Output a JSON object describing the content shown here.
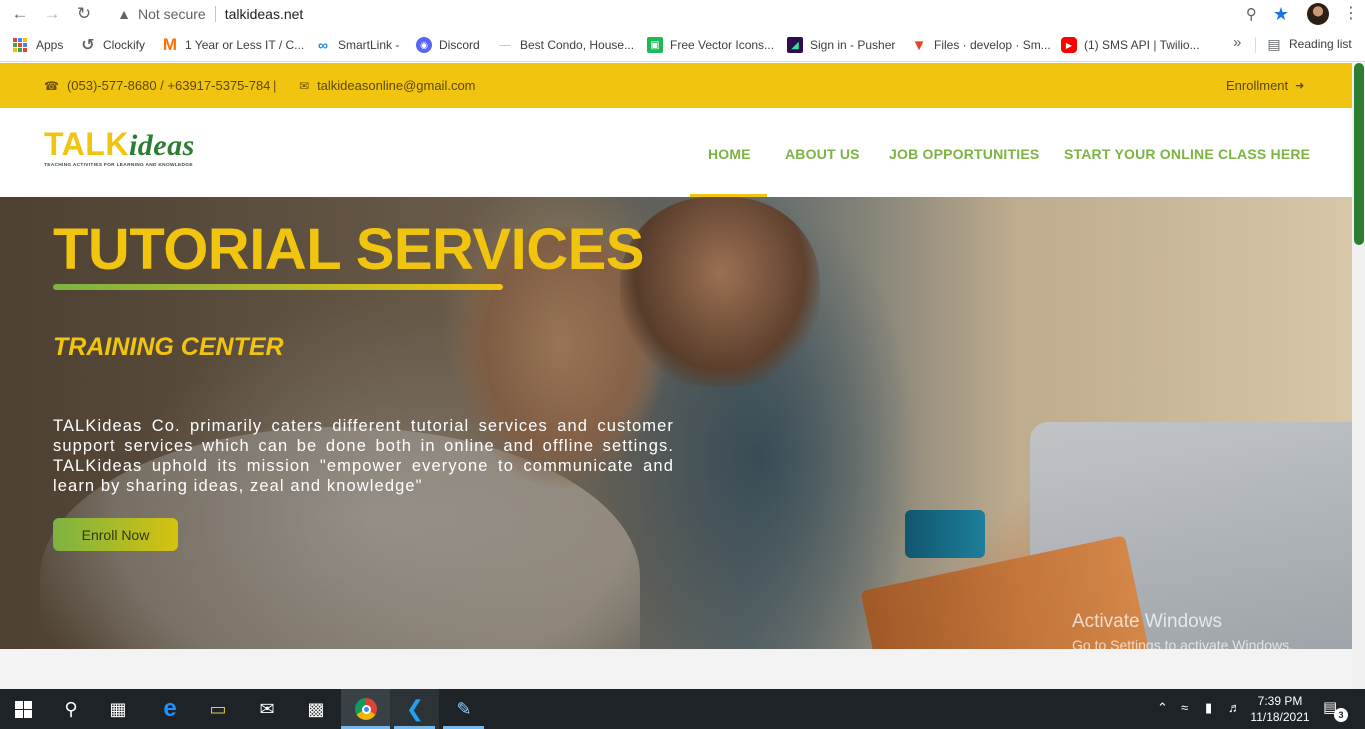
{
  "browser": {
    "not_secure": "Not secure",
    "url": "talkideas.net",
    "bookmarks": [
      {
        "label": "Apps",
        "icon": "apps-grid-icon"
      },
      {
        "label": "Clockify",
        "icon": "clockify-icon",
        "color": "#03a9f4"
      },
      {
        "label": "1 Year or Less IT / C...",
        "icon": "m-logo-icon",
        "color": "#ff6f00"
      },
      {
        "label": "SmartLink -",
        "icon": "link-icon",
        "color": "#1e88e5"
      },
      {
        "label": "Discord",
        "icon": "discord-icon",
        "color": "#5865f2"
      },
      {
        "label": "Best Condo, House...",
        "icon": "condo-icon",
        "color": "#90a4ae"
      },
      {
        "label": "Free Vector Icons...",
        "icon": "vector-icons-icon",
        "color": "#1db954"
      },
      {
        "label": "Sign in - Pusher",
        "icon": "pusher-icon",
        "color": "#300d4f"
      },
      {
        "label": "Files · develop · Sm...",
        "icon": "gitlab-icon",
        "color": "#e24329"
      },
      {
        "label": "(1) SMS API | Twilio...",
        "icon": "youtube-icon",
        "color": "#ff0000"
      }
    ],
    "more": "»",
    "reading_list": "Reading list"
  },
  "topbar": {
    "phone": "(053)-577-8680 / +63917-5375-784",
    "separator": "|",
    "email": "talkideasonline@gmail.com",
    "enrollment": "Enrollment"
  },
  "header": {
    "logo_talk": "TALK",
    "logo_ideas": "ideas",
    "logo_tagline": "TEACHING ACTIVITIES FOR LEARNING AND KNOWLEDGE",
    "nav": [
      "HOME",
      "ABOUT US",
      "JOB OPPORTUNITIES",
      "START YOUR ONLINE CLASS HERE"
    ],
    "active_nav": "HOME"
  },
  "hero": {
    "title": "TUTORIAL SERVICES",
    "subtitle": "TRAINING CENTER",
    "description": "TALKideas Co. primarily caters different tutorial services and customer support services which can be done both in online and offline settings. TALKideas uphold its mission \"empower everyone to communicate and learn by sharing ideas, zeal and knowledge\"",
    "button": "Enroll Now"
  },
  "watermark": {
    "title": "Activate Windows",
    "subtitle": "Go to Settings to activate Windows."
  },
  "taskbar": {
    "time": "7:39 PM",
    "date": "11/18/2021",
    "notifications": "3"
  },
  "colors": {
    "brand_yellow": "#f1c40f",
    "brand_green": "#7cb342"
  }
}
